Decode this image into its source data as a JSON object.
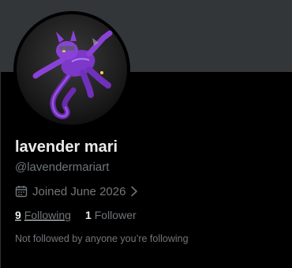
{
  "profile": {
    "display_name": "lavender mari",
    "handle": "@lavendermariart",
    "joined": "Joined June 2026",
    "following_count": "9",
    "following_label": "Following",
    "followers_count": "1",
    "followers_label": "Follower",
    "mutuals_note": "Not followed by anyone you’re following"
  },
  "icons": {
    "calendar": "calendar-icon",
    "chevron": "chevron-right-icon"
  },
  "colors": {
    "background": "#000000",
    "banner": "#333639",
    "primary_text": "#e7e9ea",
    "secondary_text": "#71767b",
    "avatar_character": "#8a3fd0"
  }
}
